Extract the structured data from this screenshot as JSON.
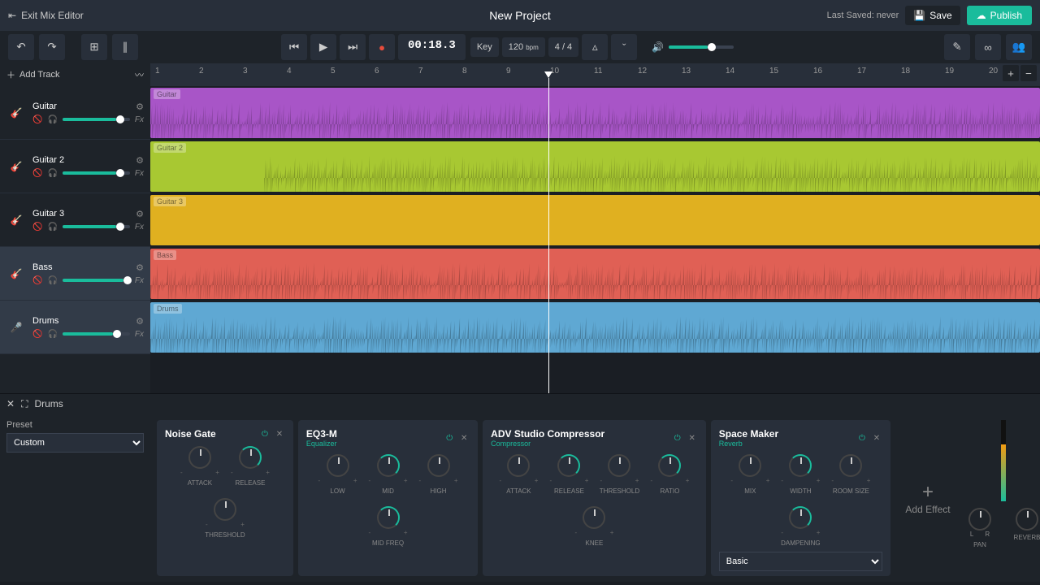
{
  "header": {
    "exit_label": "Exit Mix Editor",
    "project_title": "New Project",
    "last_saved": "Last Saved: never",
    "save_label": "Save",
    "publish_label": "Publish"
  },
  "transport": {
    "time": "00:18.3",
    "key_label": "Key",
    "tempo": "120",
    "tempo_unit": "bpm",
    "time_sig": "4 / 4"
  },
  "ruler_marks": [
    1,
    2,
    3,
    4,
    5,
    6,
    7,
    8,
    9,
    10,
    11,
    12,
    13,
    14,
    15,
    16,
    17,
    18,
    19,
    20
  ],
  "sidebar": {
    "add_track_label": "Add Track"
  },
  "tracks": [
    {
      "name": "Guitar",
      "color": "#a855c7",
      "clip_label": "Guitar",
      "icon": "guitar",
      "volume": 80,
      "wave_opacity": 0.9,
      "start": 0
    },
    {
      "name": "Guitar 2",
      "color": "#a8c832",
      "clip_label": "Guitar 2",
      "icon": "guitar",
      "volume": 80,
      "wave_opacity": 0.9,
      "start": 140
    },
    {
      "name": "Guitar 3",
      "color": "#e0b020",
      "clip_label": "Guitar 3",
      "icon": "guitar",
      "volume": 80,
      "wave_opacity": 0.0,
      "start": 0
    },
    {
      "name": "Bass",
      "color": "#e06055",
      "clip_label": "Bass",
      "icon": "guitar",
      "volume": 90,
      "wave_opacity": 0.85,
      "start": 0,
      "selected": true
    },
    {
      "name": "Drums",
      "color": "#5fa8d3",
      "clip_label": "Drums",
      "icon": "mic",
      "volume": 75,
      "wave_opacity": 1.0,
      "start": 0,
      "selected": true
    }
  ],
  "effects_panel": {
    "header_track": "Drums",
    "preset_label": "Preset",
    "preset_value": "Custom",
    "add_effect_label": "Add Effect",
    "modules": [
      {
        "title": "Noise Gate",
        "subtitle": "",
        "knobs": [
          "Attack",
          "Release",
          "Threshold"
        ]
      },
      {
        "title": "EQ3-M",
        "subtitle": "Equalizer",
        "knobs": [
          "Low",
          "Mid",
          "High",
          "Mid Freq"
        ]
      },
      {
        "title": "ADV Studio Compressor",
        "subtitle": "Compressor",
        "knobs": [
          "Attack",
          "Release",
          "Threshold",
          "Ratio",
          "Knee"
        ]
      },
      {
        "title": "Space Maker",
        "subtitle": "Reverb",
        "knobs": [
          "Mix",
          "Width",
          "Room Size",
          "Dampening"
        ],
        "preset": "Basic"
      }
    ],
    "master_knobs": [
      "Pan",
      "Reverb"
    ],
    "lr_label_l": "L",
    "lr_label_r": "R"
  }
}
